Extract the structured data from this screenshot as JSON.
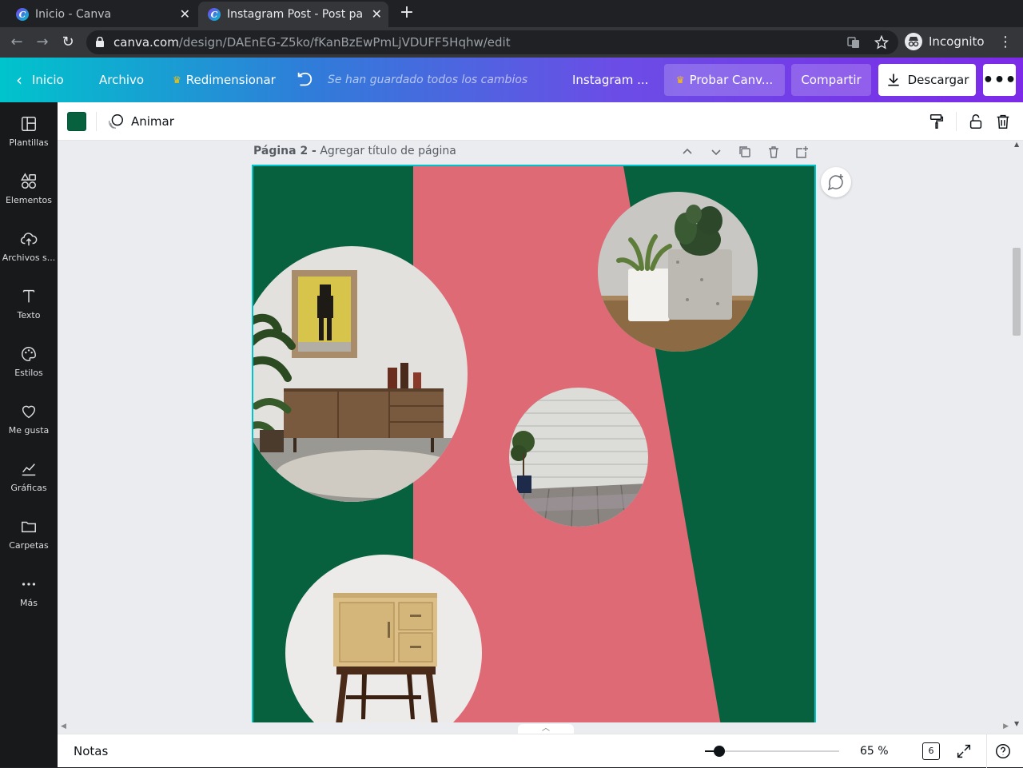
{
  "browser": {
    "tabs": [
      {
        "favicon": "C",
        "title": "Inicio - Canva"
      },
      {
        "favicon": "C",
        "title": "Instagram Post - Post para"
      }
    ],
    "url_host": "canva.com",
    "url_path": "/design/DAEnEG-Z5ko/fKanBzEwPmLjVDUFF5Hqhw/edit",
    "profile_label": "Incognito"
  },
  "header": {
    "home": "Inicio",
    "file": "Archivo",
    "resize": "Redimensionar",
    "saved_status": "Se han guardado todos los cambios",
    "design_title": "Instagram ...",
    "try_pro": "Probar Canv...",
    "share": "Compartir",
    "download": "Descargar"
  },
  "sidebar": {
    "items": [
      {
        "label": "Plantillas",
        "icon": "templates-icon"
      },
      {
        "label": "Elementos",
        "icon": "elements-icon"
      },
      {
        "label": "Archivos s...",
        "icon": "upload-icon"
      },
      {
        "label": "Texto",
        "icon": "text-icon"
      },
      {
        "label": "Estilos",
        "icon": "palette-icon"
      },
      {
        "label": "Me gusta",
        "icon": "heart-icon"
      },
      {
        "label": "Gráficas",
        "icon": "chart-icon"
      },
      {
        "label": "Carpetas",
        "icon": "folder-icon"
      },
      {
        "label": "Más",
        "icon": "more-icon"
      }
    ]
  },
  "toolbar": {
    "swatch_color": "#07613f",
    "animate": "Animar"
  },
  "page": {
    "label_bold": "Página 2 -",
    "label_placeholder": "Agregar título de página",
    "background_color": "#07613f",
    "shape_color": "#de6a75"
  },
  "footer": {
    "notes": "Notas",
    "zoom": "65 %",
    "zoom_level": 0.11,
    "page_count": "6"
  },
  "colors": {
    "accent": "#00c4cc",
    "purple": "#7d2ae8"
  }
}
